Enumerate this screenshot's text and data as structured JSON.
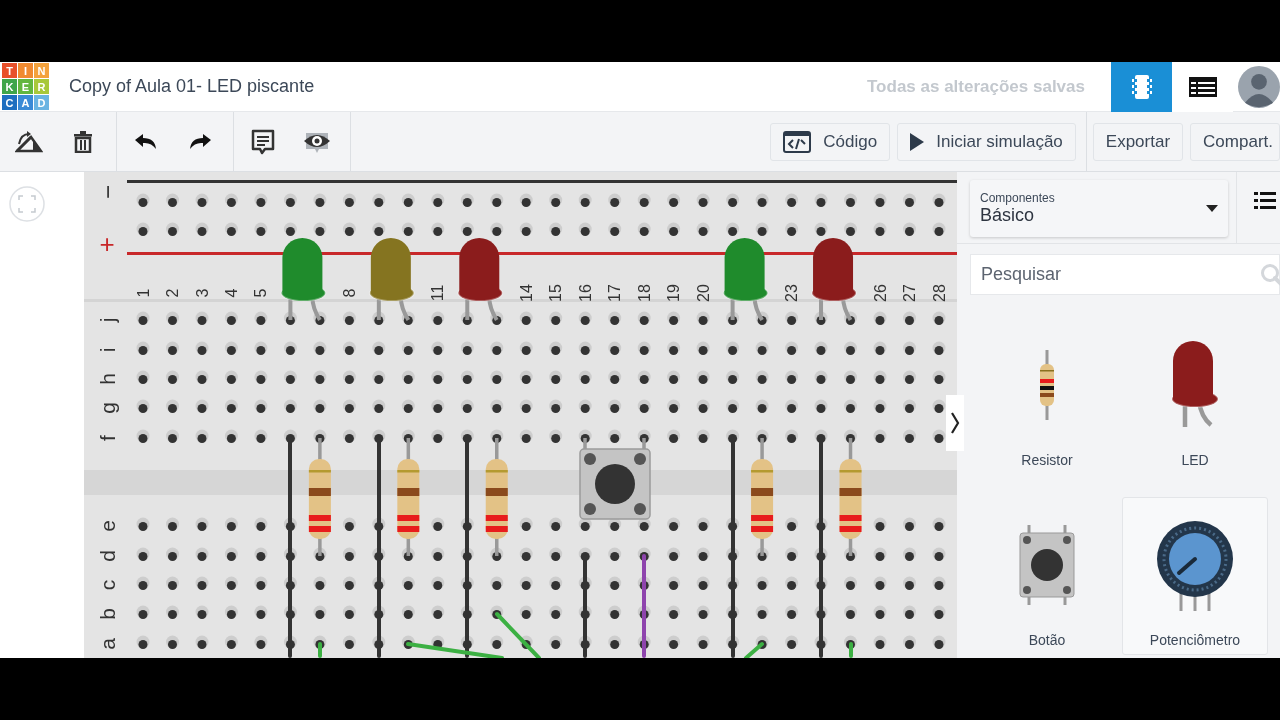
{
  "logo": {
    "tiles": [
      {
        "letter": "T",
        "color": "#e8502a"
      },
      {
        "letter": "I",
        "color": "#f08a30"
      },
      {
        "letter": "N",
        "color": "#f4a23c"
      },
      {
        "letter": "K",
        "color": "#3fa54a"
      },
      {
        "letter": "E",
        "color": "#62b63e"
      },
      {
        "letter": "R",
        "color": "#a8c83a"
      },
      {
        "letter": "C",
        "color": "#1e6fc0"
      },
      {
        "letter": "A",
        "color": "#3a8ad6"
      },
      {
        "letter": "D",
        "color": "#6ab4e2"
      }
    ]
  },
  "title": "Copy of Aula 01- LED piscante",
  "save_status": "Todas as alterações salvas",
  "view_buttons": [
    {
      "kind": "breadboard",
      "selected": true
    },
    {
      "kind": "table",
      "selected": false
    }
  ],
  "toolbar": {
    "tool_groups": [
      [
        {
          "kind": "rotate"
        },
        {
          "kind": "delete"
        }
      ],
      [
        {
          "kind": "undo"
        },
        {
          "kind": "redo"
        }
      ],
      [
        {
          "kind": "notes"
        },
        {
          "kind": "visibility"
        }
      ]
    ],
    "buttons": [
      {
        "kind": "code",
        "label": "Código"
      },
      {
        "kind": "start",
        "label": "Iniciar simulação"
      },
      {
        "kind": "plain",
        "label": "Exportar"
      },
      {
        "kind": "plain",
        "label": "Compart."
      }
    ]
  },
  "breadboard": {
    "rail_signs": [
      "−",
      "+"
    ],
    "column_labels": [
      "1",
      "2",
      "3",
      "4",
      "5",
      "8",
      "11",
      "14",
      "15",
      "16",
      "17",
      "18",
      "19",
      "20",
      "23",
      "26",
      "27",
      "28"
    ],
    "row_labels_top": [
      "j",
      "i",
      "h",
      "g",
      "f"
    ],
    "row_labels_bottom": [
      "e",
      "d",
      "c",
      "b",
      "a"
    ],
    "leds": [
      {
        "color": "#1f8b2c"
      },
      {
        "color": "#857420"
      },
      {
        "color": "#8b1c1c"
      },
      {
        "color": "#1f8b2c"
      },
      {
        "color": "#8b1c1c"
      }
    ],
    "wires": [
      {
        "color": "#333333"
      },
      {
        "color": "#333333"
      },
      {
        "color": "#333333"
      },
      {
        "color": "#333333"
      },
      {
        "color": "#333333"
      },
      {
        "color": "#333333"
      },
      {
        "color": "#8e44ad"
      },
      {
        "color": "#3cb043"
      },
      {
        "color": "#3cb043"
      },
      {
        "color": "#3cb043"
      },
      {
        "color": "#3cb043"
      },
      {
        "color": "#3cb043"
      }
    ]
  },
  "components_panel": {
    "dropdown": {
      "label": "Componentes",
      "value": "Básico"
    },
    "search": {
      "placeholder": "Pesquisar"
    },
    "items": [
      {
        "kind": "resistor",
        "label": "Resistor",
        "selected": false
      },
      {
        "kind": "led",
        "label": "LED",
        "selected": false
      },
      {
        "kind": "pushbutton",
        "label": "Botão",
        "selected": false
      },
      {
        "kind": "potentiometer",
        "label": "Potenciômetro",
        "selected": true
      }
    ]
  }
}
